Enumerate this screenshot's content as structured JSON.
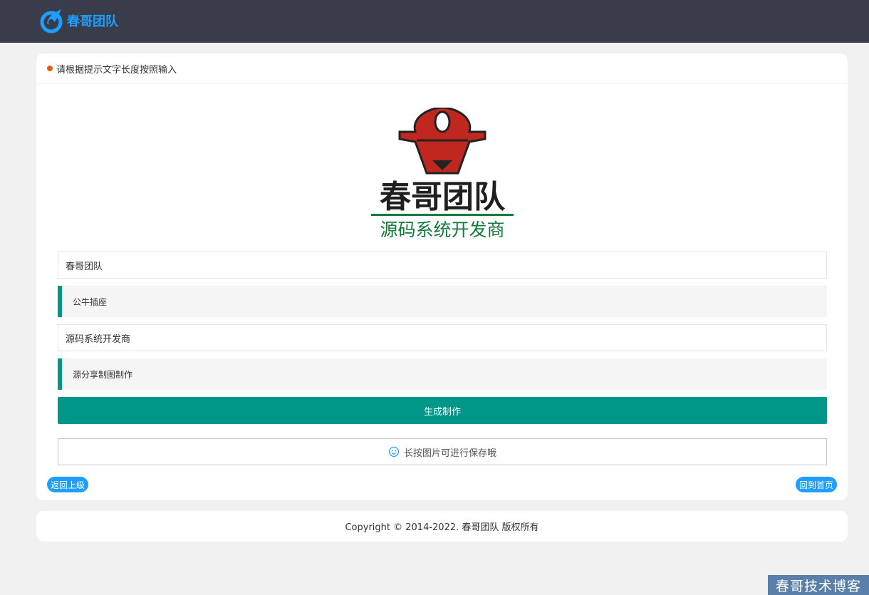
{
  "header": {
    "brand_name": "春哥团队",
    "bg_color": "#393d49",
    "brand_color": "#1e9fff"
  },
  "card": {
    "notice": "请根据提示文字长度按照输入",
    "hero_image": {
      "brand_text": "春哥团队",
      "slogan": "源码系统开发商"
    },
    "inputs": [
      {
        "value": "春哥团队",
        "hint": "公牛插座"
      },
      {
        "value": "源码系统开发商",
        "hint": "源分享制图制作"
      }
    ],
    "generate_label": "生成制作",
    "save_tip": "长按图片可进行保存哦",
    "back_label": "返回上级",
    "home_label": "回到首页",
    "accent_color": "#009688"
  },
  "footer": {
    "copyright": "Copyright © 2014-2022. 春哥团队 版权所有"
  },
  "watermark": "春哥技术博客"
}
